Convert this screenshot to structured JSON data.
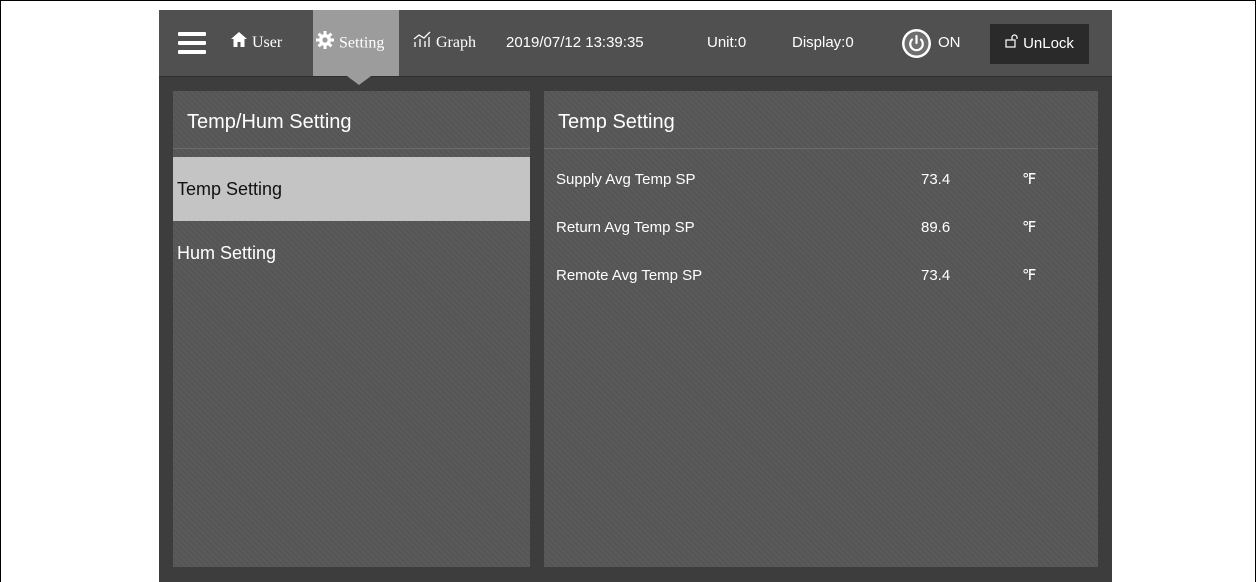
{
  "topbar": {
    "menu_icon": "hamburger-icon",
    "nav": [
      {
        "label": "User",
        "icon": "home-icon"
      },
      {
        "label": "Setting",
        "icon": "gear-icon",
        "active": true
      },
      {
        "label": "Graph",
        "icon": "graph-icon"
      }
    ],
    "datetime": "2019/07/12 13:39:35",
    "unit": "Unit:0",
    "display": "Display:0",
    "power_label": "ON",
    "lock_label": "UnLock",
    "accent_color": "#9c9c9c"
  },
  "sidebar": {
    "title": "Temp/Hum Setting",
    "items": [
      {
        "label": "Temp Setting",
        "active": true
      },
      {
        "label": "Hum Setting",
        "active": false
      }
    ]
  },
  "main": {
    "title": "Temp Setting",
    "rows": [
      {
        "label": "Supply Avg Temp SP",
        "value": "73.4",
        "unit": "℉"
      },
      {
        "label": "Return Avg Temp SP",
        "value": "89.6",
        "unit": "℉"
      },
      {
        "label": "Remote Avg Temp SP",
        "value": "73.4",
        "unit": "℉"
      }
    ]
  }
}
